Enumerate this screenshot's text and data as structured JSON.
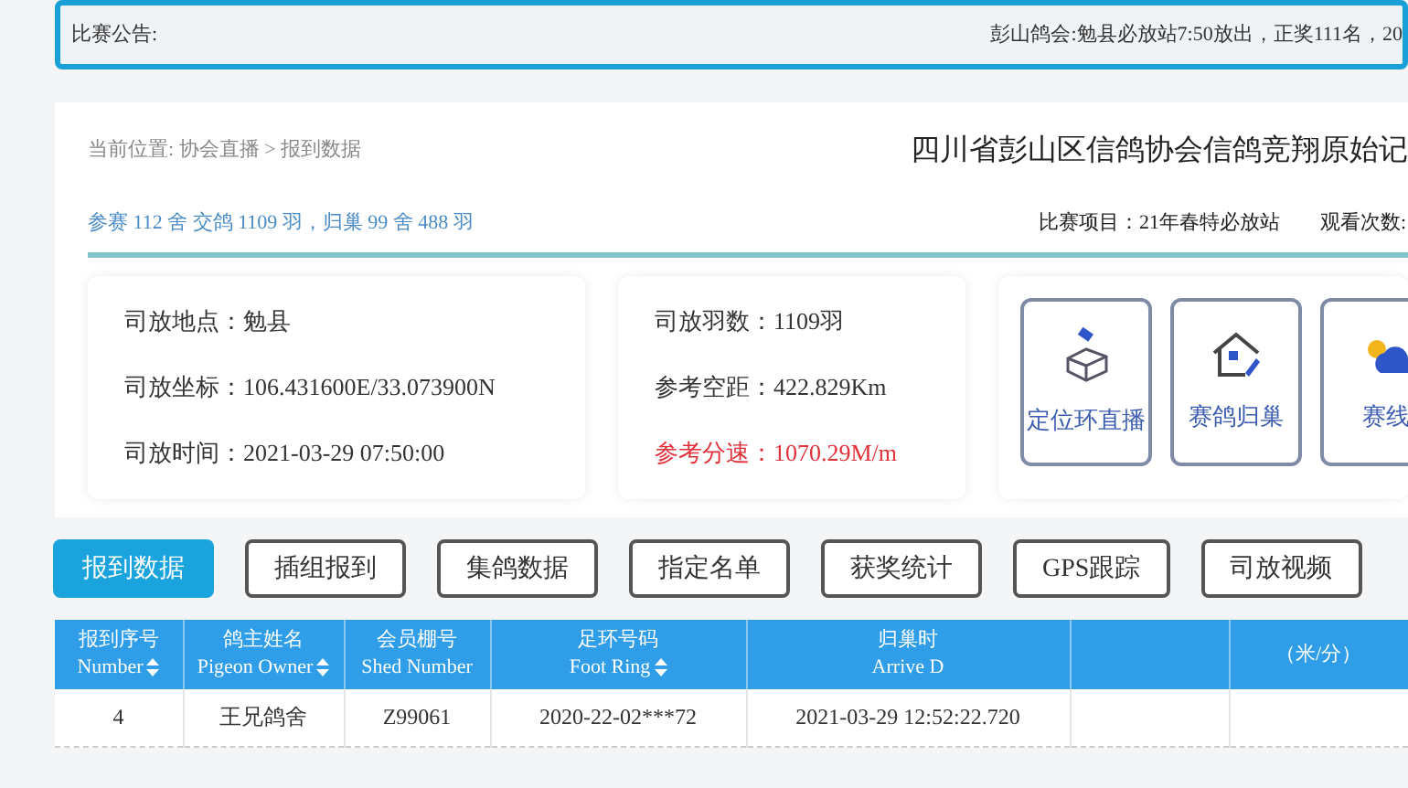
{
  "announcement": {
    "label": "比赛公告:",
    "text": "彭山鸽会:勉县必放站7:50放出，正奖111名，20"
  },
  "breadcrumb": {
    "label": "当前位置:",
    "path": "协会直播 > 报到数据"
  },
  "page_title": "四川省彭山区信鸽协会信鸽竞翔原始记",
  "summary": "参赛 112 舍 交鸽 1109 羽，归巢 99 舍 488 羽",
  "race_item": "比赛项目：21年春特必放站",
  "views_label": "观看次数:",
  "release_info": [
    {
      "label": "司放地点：",
      "value": "勉县",
      "highlight": false
    },
    {
      "label": "司放坐标：",
      "value": "106.431600E/33.073900N",
      "highlight": false
    },
    {
      "label": "司放时间：",
      "value": "2021-03-29 07:50:00",
      "highlight": false
    }
  ],
  "flight_info": [
    {
      "label": "司放羽数：",
      "value": "1109羽",
      "highlight": false
    },
    {
      "label": "参考空距：",
      "value": "422.829Km",
      "highlight": false
    },
    {
      "label": "参考分速：",
      "value": "1070.29M/m",
      "highlight": true
    }
  ],
  "shortcuts": [
    {
      "label": "定位环直播",
      "kind": "satellite"
    },
    {
      "label": "赛鸽归巢",
      "kind": "house"
    },
    {
      "label": "赛线",
      "kind": "weather"
    }
  ],
  "tabs": [
    {
      "label": "报到数据",
      "selected": true
    },
    {
      "label": "插组报到",
      "selected": false
    },
    {
      "label": "集鸽数据",
      "selected": false
    },
    {
      "label": "指定名单",
      "selected": false
    },
    {
      "label": "获奖统计",
      "selected": false
    },
    {
      "label": "GPS跟踪",
      "selected": false
    },
    {
      "label": "司放视频",
      "selected": false
    }
  ],
  "table": {
    "columns": [
      {
        "zh": "报到序号",
        "en": "Number",
        "sortable": true
      },
      {
        "zh": "鸽主姓名",
        "en": "Pigeon Owner",
        "sortable": true
      },
      {
        "zh": "会员棚号",
        "en": "Shed Number",
        "sortable": false
      },
      {
        "zh": "足环号码",
        "en": "Foot Ring",
        "sortable": true
      },
      {
        "zh": "归巢时",
        "en": "Arrive D",
        "sortable": false
      },
      {
        "sortable": false
      },
      {
        "zh": "（米/分）",
        "sortable": false
      }
    ],
    "rows": [
      [
        "4",
        "王兄鸽舍",
        "Z99061",
        "2020-22-02***72",
        "2021-03-29 12:52:22.720",
        "",
        ""
      ]
    ]
  }
}
